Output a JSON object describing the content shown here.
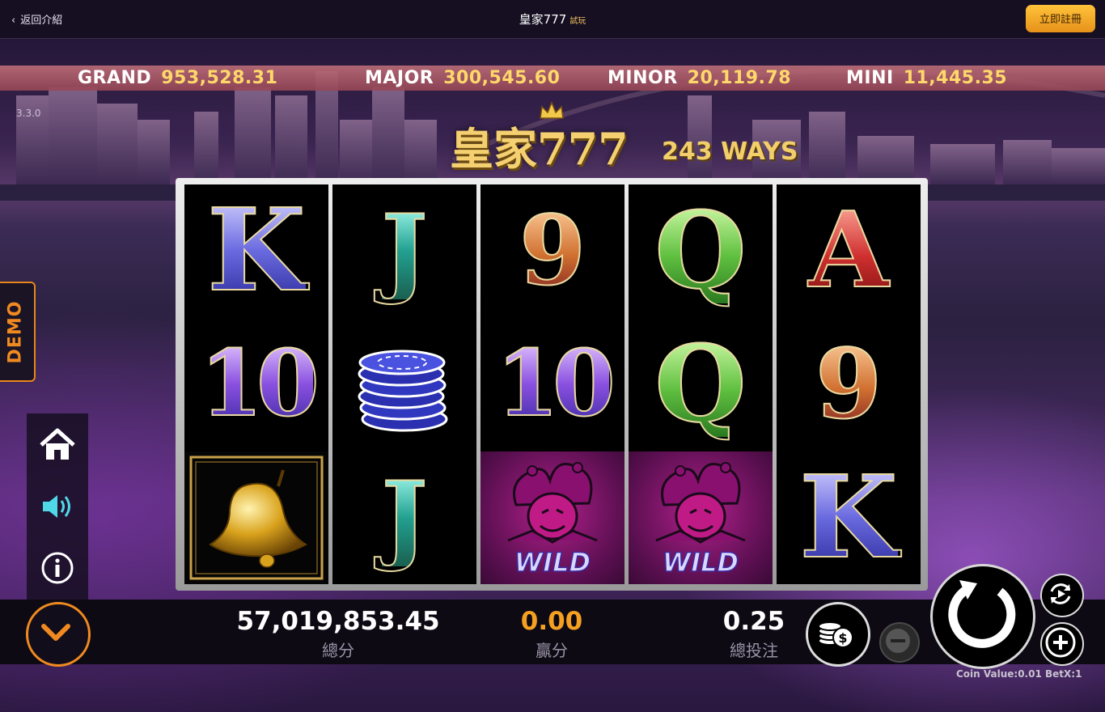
{
  "header": {
    "back_label": "返回介紹",
    "title": "皇家777",
    "title_sub": "試玩",
    "register_label": "立即註冊"
  },
  "jackpots": [
    {
      "label": "GRAND",
      "value": "953,528.31"
    },
    {
      "label": "MAJOR",
      "value": "300,545.60"
    },
    {
      "label": "MINOR",
      "value": "20,119.78"
    },
    {
      "label": "MINI",
      "value": "11,445.35"
    }
  ],
  "version": "3.3.0",
  "game_logo": {
    "name": "皇家777",
    "ways": "243 WAYS"
  },
  "reels": [
    [
      "K",
      "10",
      "bell"
    ],
    [
      "J",
      "chips",
      "J"
    ],
    [
      "9",
      "10",
      "wild"
    ],
    [
      "Q",
      "Q",
      "wild"
    ],
    [
      "A",
      "9",
      "K"
    ]
  ],
  "wild_label": "WILD",
  "demo_tab": "DEMO",
  "side_menu": {
    "home": "home-icon",
    "sound": "speaker-icon",
    "info": "info-icon"
  },
  "stats": {
    "balance": {
      "value": "57,019,853.45",
      "label": "總分"
    },
    "win": {
      "value": "0.00",
      "label": "贏分"
    },
    "bet": {
      "value": "0.25",
      "label": "總投注"
    }
  },
  "coin_info": "Coin Value:0.01  BetX:1",
  "colors": {
    "accent_orange": "#f08a20",
    "win_value": "#f5a020",
    "jackpot_value": "#ffd86a"
  }
}
